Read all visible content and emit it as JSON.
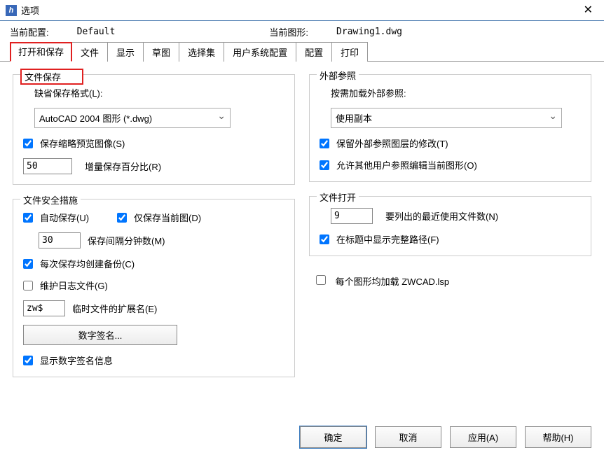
{
  "title": "选项",
  "appIcon": "h",
  "config": {
    "currentConfigLabel": "当前配置:",
    "currentConfigValue": "Default",
    "currentDrawingLabel": "当前图形:",
    "currentDrawingValue": "Drawing1.dwg"
  },
  "tabs": {
    "openSave": "打开和保存",
    "file": "文件",
    "display": "显示",
    "sketch": "草图",
    "selection": "选择集",
    "userPrefs": "用户系统配置",
    "config": "配置",
    "print": "打印"
  },
  "fileSave": {
    "groupTitle": "文件保存",
    "defaultFormatLabel": "缺省保存格式(L):",
    "defaultFormatValue": "AutoCAD 2004 图形 (*.dwg)",
    "thumbSave": "保存缩略预览图像(S)",
    "incPercentValue": "50",
    "incPercentLabel": "增量保存百分比(R)"
  },
  "fileSafety": {
    "groupTitle": "文件安全措施",
    "autoSave": "自动保存(U)",
    "saveCurrentOnly": "仅保存当前图(D)",
    "intervalValue": "30",
    "intervalLabel": "保存间隔分钟数(M)",
    "backupEach": "每次保存均创建备份(C)",
    "maintainLog": "维护日志文件(G)",
    "tempExtValue": "zw$",
    "tempExtLabel": "临时文件的扩展名(E)",
    "digitalSigBtn": "数字签名...",
    "showDigitalSig": "显示数字签名信息"
  },
  "xref": {
    "groupTitle": "外部参照",
    "loadOnDemandLabel": "按需加载外部参照:",
    "loadOnDemandValue": "使用副本",
    "retainLayerChanges": "保留外部参照图层的修改(T)",
    "allowOtherEdit": "允许其他用户参照编辑当前图形(O)"
  },
  "fileOpen": {
    "groupTitle": "文件打开",
    "recentCountValue": "9",
    "recentCountLabel": "要列出的最近使用文件数(N)",
    "showFullPath": "在标题中显示完整路径(F)"
  },
  "loadLsp": "每个图形均加载 ZWCAD.lsp",
  "buttons": {
    "ok": "确定",
    "cancel": "取消",
    "apply": "应用(A)",
    "help": "帮助(H)"
  }
}
